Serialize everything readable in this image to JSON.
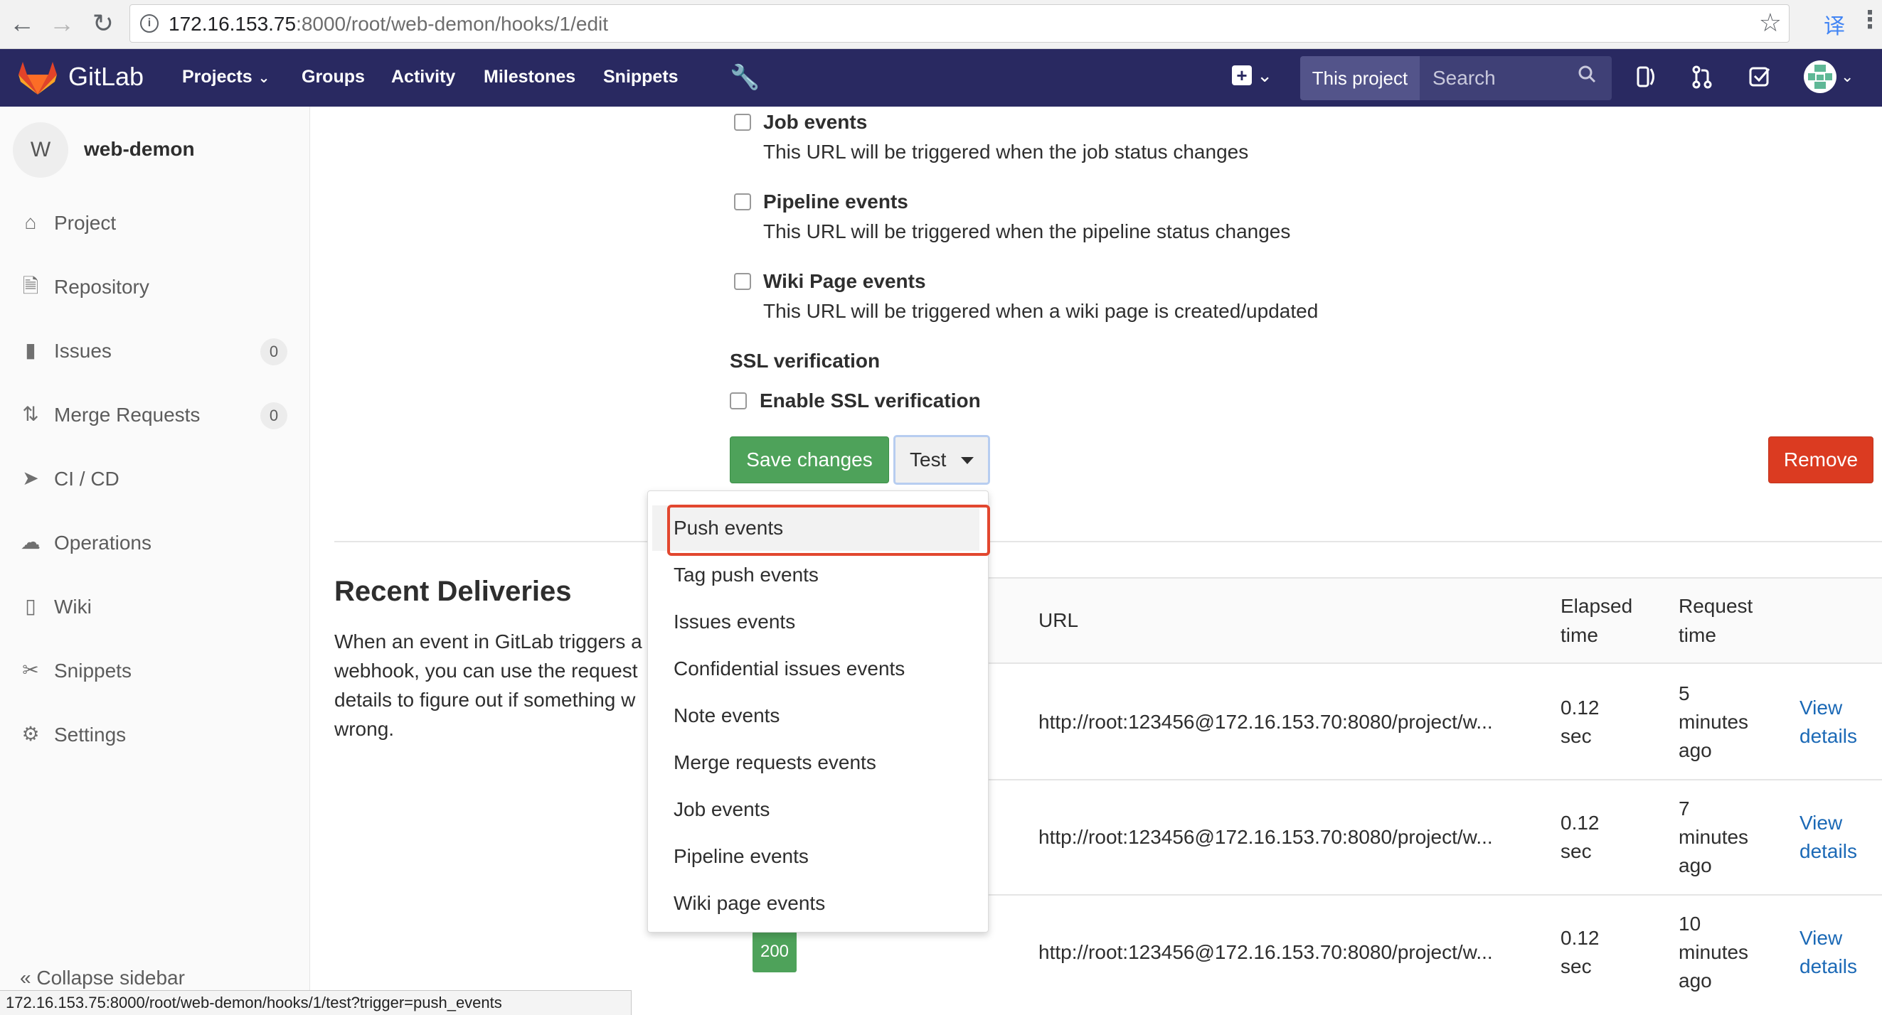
{
  "browser": {
    "url_host": "172.16.153.75",
    "url_rest": ":8000/root/web-demon/hooks/1/edit",
    "translate_glyph": "译",
    "status_url": "172.16.153.75:8000/root/web-demon/hooks/1/test?trigger=push_events"
  },
  "header": {
    "brand": "GitLab",
    "nav": [
      "Projects",
      "Groups",
      "Activity",
      "Milestones",
      "Snippets"
    ],
    "this_project": "This project",
    "search_placeholder": "Search"
  },
  "sidebar": {
    "avatar_letter": "W",
    "project_name": "web-demon",
    "items": [
      {
        "label": "Project",
        "icon": "home-icon"
      },
      {
        "label": "Repository",
        "icon": "doc-icon"
      },
      {
        "label": "Issues",
        "icon": "issues-icon",
        "count": "0"
      },
      {
        "label": "Merge Requests",
        "icon": "merge-icon",
        "count": "0"
      },
      {
        "label": "CI / CD",
        "icon": "rocket-icon"
      },
      {
        "label": "Operations",
        "icon": "cloud-icon"
      },
      {
        "label": "Wiki",
        "icon": "book-icon"
      },
      {
        "label": "Snippets",
        "icon": "scissors-icon"
      },
      {
        "label": "Settings",
        "icon": "gear-icon"
      }
    ],
    "collapse": "Collapse sidebar"
  },
  "triggers": [
    {
      "label": "Job events",
      "help": "This URL will be triggered when the job status changes"
    },
    {
      "label": "Pipeline events",
      "help": "This URL will be triggered when the pipeline status changes"
    },
    {
      "label": "Wiki Page events",
      "help": "This URL will be triggered when a wiki page is created/updated"
    }
  ],
  "ssl": {
    "heading": "SSL verification",
    "label": "Enable SSL verification"
  },
  "buttons": {
    "save": "Save changes",
    "test": "Test",
    "remove": "Remove"
  },
  "test_menu": [
    "Push events",
    "Tag push events",
    "Issues events",
    "Confidential issues events",
    "Note events",
    "Merge requests events",
    "Job events",
    "Pipeline events",
    "Wiki page events"
  ],
  "recent": {
    "title": "Recent Deliveries",
    "desc_lines": [
      "When an event in GitLab triggers a",
      "webhook, you can use the request",
      "details to figure out if something w",
      "wrong."
    ]
  },
  "table": {
    "headers": {
      "url": "URL",
      "elapsed": [
        "Elapsed",
        "time"
      ],
      "request": [
        "Request",
        "time"
      ]
    },
    "rows": [
      {
        "url": "http://root:123456@172.16.153.70:8080/project/w...",
        "elapsed": [
          "0.12",
          "sec"
        ],
        "request": [
          "5",
          "minutes",
          "ago"
        ],
        "action": [
          "View",
          "details"
        ]
      },
      {
        "url": "http://root:123456@172.16.153.70:8080/project/w...",
        "elapsed": [
          "0.12",
          "sec"
        ],
        "request": [
          "7",
          "minutes",
          "ago"
        ],
        "action": [
          "View",
          "details"
        ]
      },
      {
        "url": "http://root:123456@172.16.153.70:8080/project/w...",
        "elapsed": [
          "0.12",
          "sec"
        ],
        "request": [
          "10",
          "minutes",
          "ago"
        ],
        "action": [
          "View",
          "details"
        ],
        "status": "200"
      }
    ]
  },
  "colors": {
    "header": "#292961",
    "save": "#4ea25a",
    "remove": "#db3b21",
    "link": "#1b69b6",
    "highlight_outline": "#e2472f"
  }
}
